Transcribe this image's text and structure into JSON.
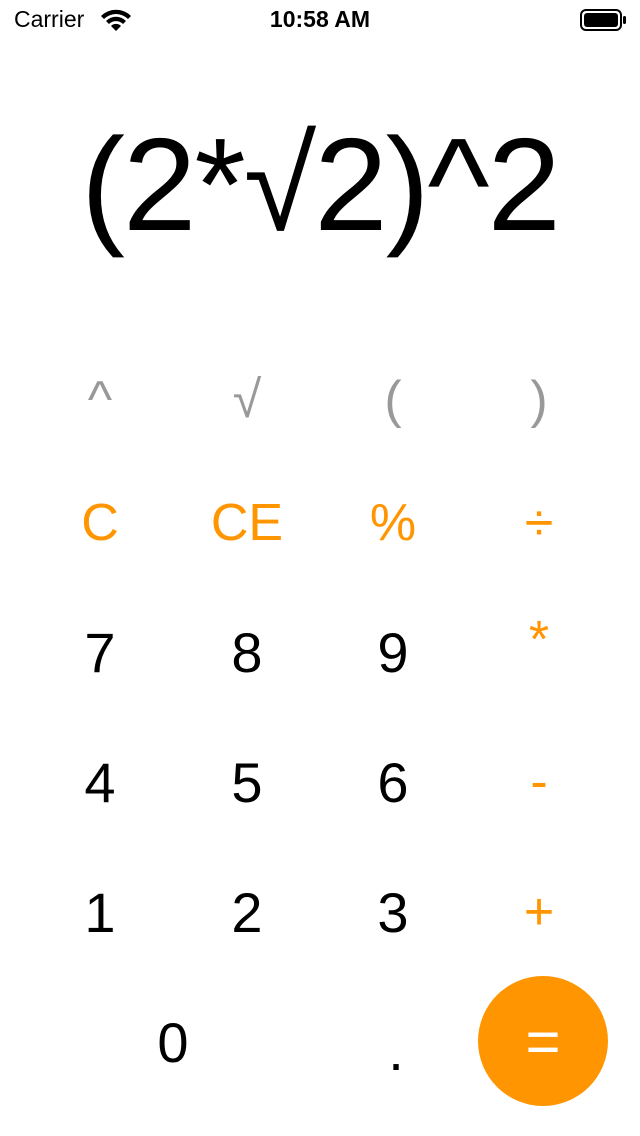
{
  "status_bar": {
    "carrier": "Carrier",
    "time": "10:58 AM",
    "wifi_icon": "wifi-icon",
    "battery_icon": "battery-icon"
  },
  "display": {
    "expression": "(2*√2)^2"
  },
  "keys": {
    "power": "^",
    "sqrt": "√",
    "open_paren": "(",
    "close_paren": ")",
    "clear": "C",
    "clear_entry": "CE",
    "percent": "%",
    "divide": "÷",
    "seven": "7",
    "eight": "8",
    "nine": "9",
    "multiply": "*",
    "four": "4",
    "five": "5",
    "six": "6",
    "minus": "-",
    "one": "1",
    "two": "2",
    "three": "3",
    "plus": "+",
    "zero": "0",
    "decimal": ".",
    "equals": "="
  },
  "colors": {
    "accent": "#ff9500",
    "function_key": "#999999",
    "number_key": "#000000",
    "background": "#ffffff"
  }
}
